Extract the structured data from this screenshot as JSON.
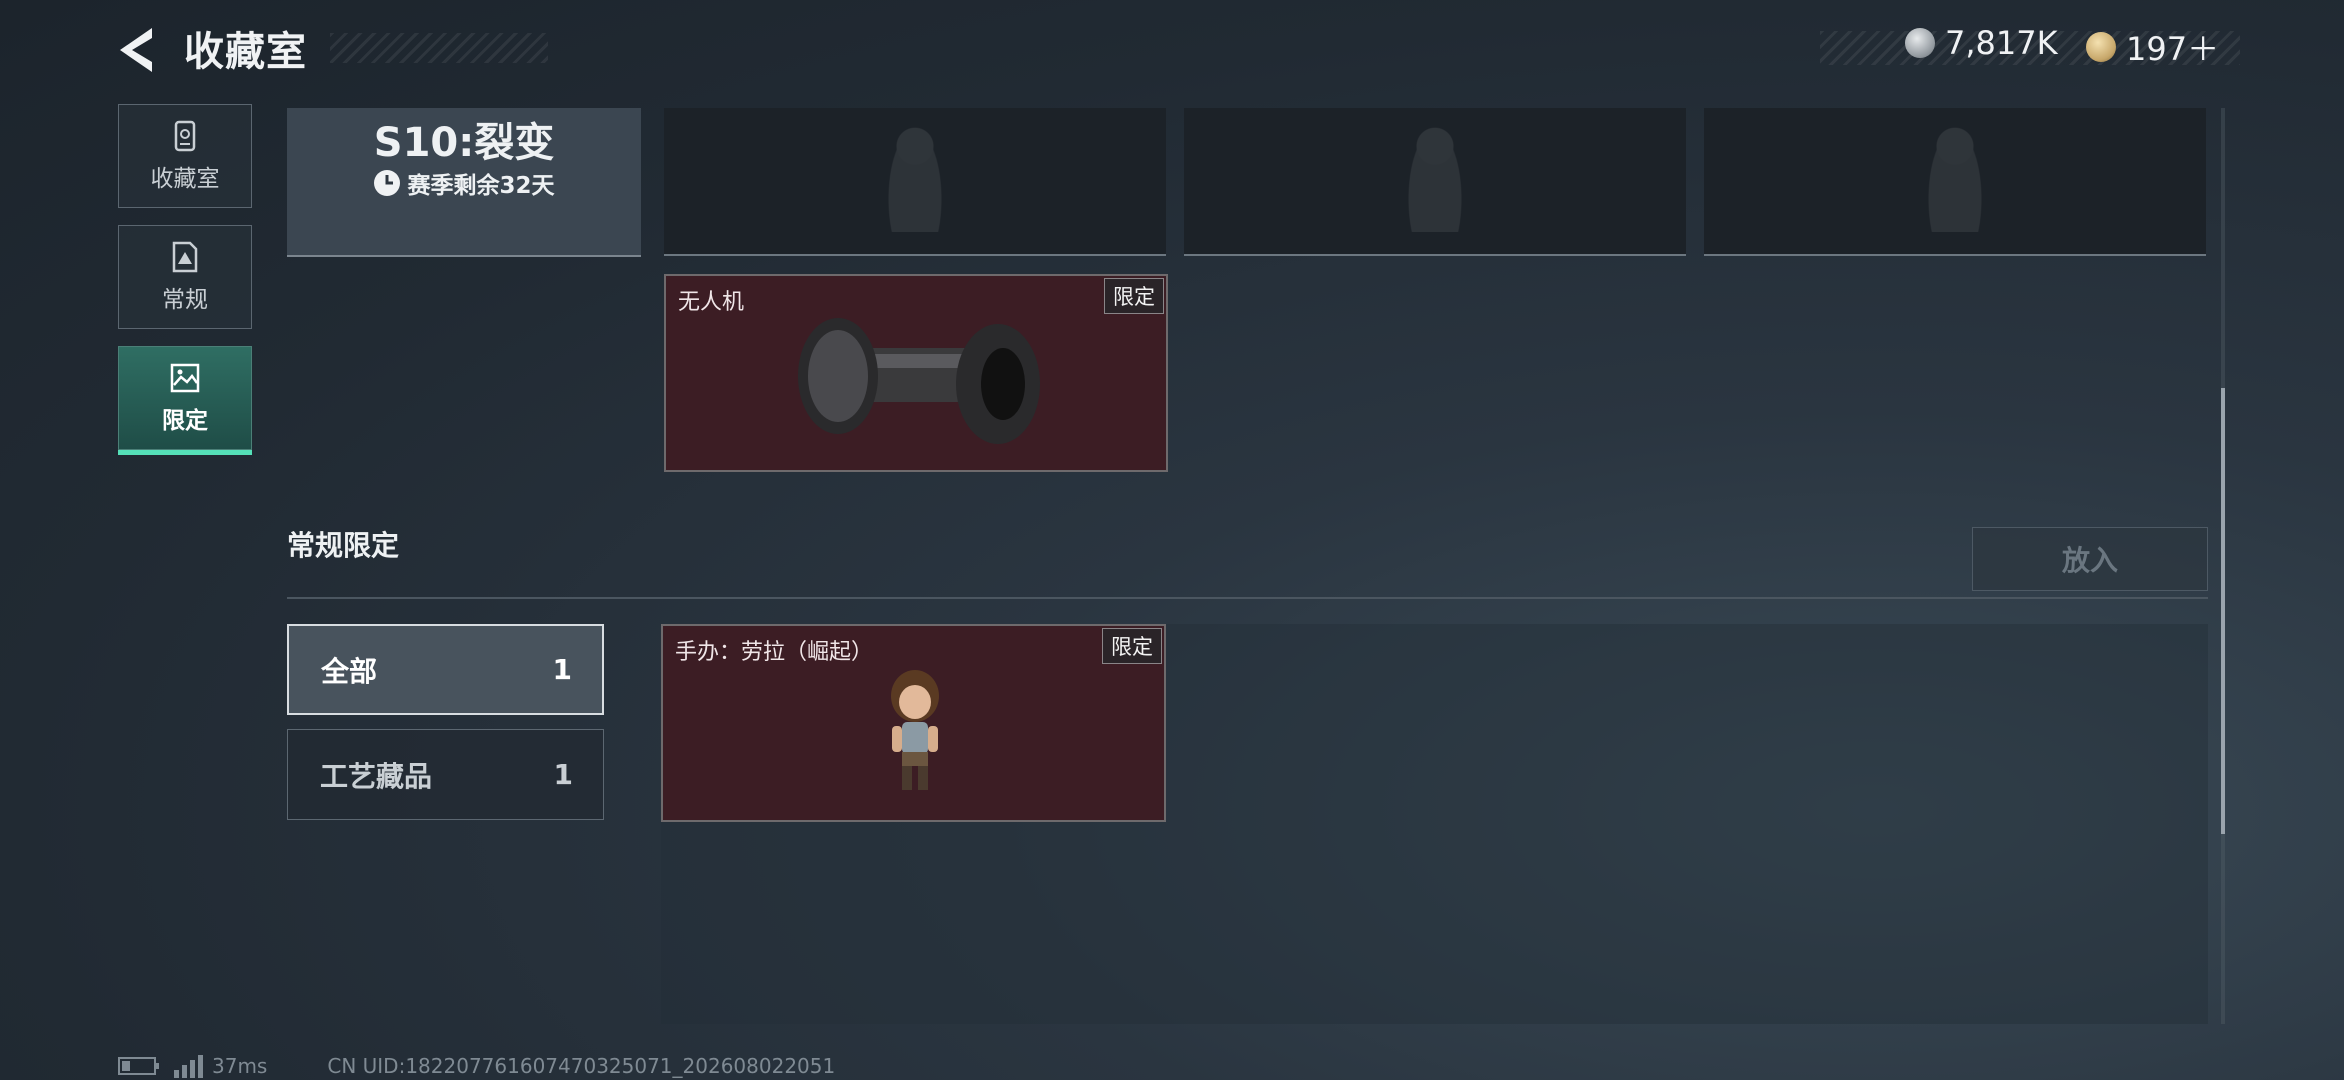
{
  "header": {
    "title": "收藏室",
    "currencies": [
      {
        "value": "7,817K",
        "icon": "silver-coin-icon",
        "color": "#a6adb3"
      },
      {
        "value": "197＋",
        "icon": "gold-triangle-coin-icon",
        "color": "#c7a76a"
      }
    ]
  },
  "sidebar": {
    "items": [
      {
        "label": "收藏室",
        "icon": "locker-icon",
        "active": false
      },
      {
        "label": "常规",
        "icon": "document-icon",
        "active": false
      },
      {
        "label": "限定",
        "icon": "picture-icon",
        "active": true
      }
    ]
  },
  "season": {
    "title": "S10:裂变",
    "remaining": "赛季剩余32天"
  },
  "limited_items": [
    {
      "name": "无人机",
      "tag": "限定"
    }
  ],
  "section": {
    "title": "常规限定",
    "put_in_label": "放入",
    "filters": [
      {
        "label": "全部",
        "count": "1",
        "active": true
      },
      {
        "label": "工艺藏品",
        "count": "1",
        "active": false
      }
    ],
    "items": [
      {
        "name": "手办：劳拉（崛起）",
        "tag": "限定"
      }
    ]
  },
  "footer": {
    "ping": "37ms",
    "uid": "CN UID:182207761607470325071_202608022051"
  },
  "colors": {
    "accent": "#55e0b8",
    "limited_card": "#3c1d24"
  }
}
